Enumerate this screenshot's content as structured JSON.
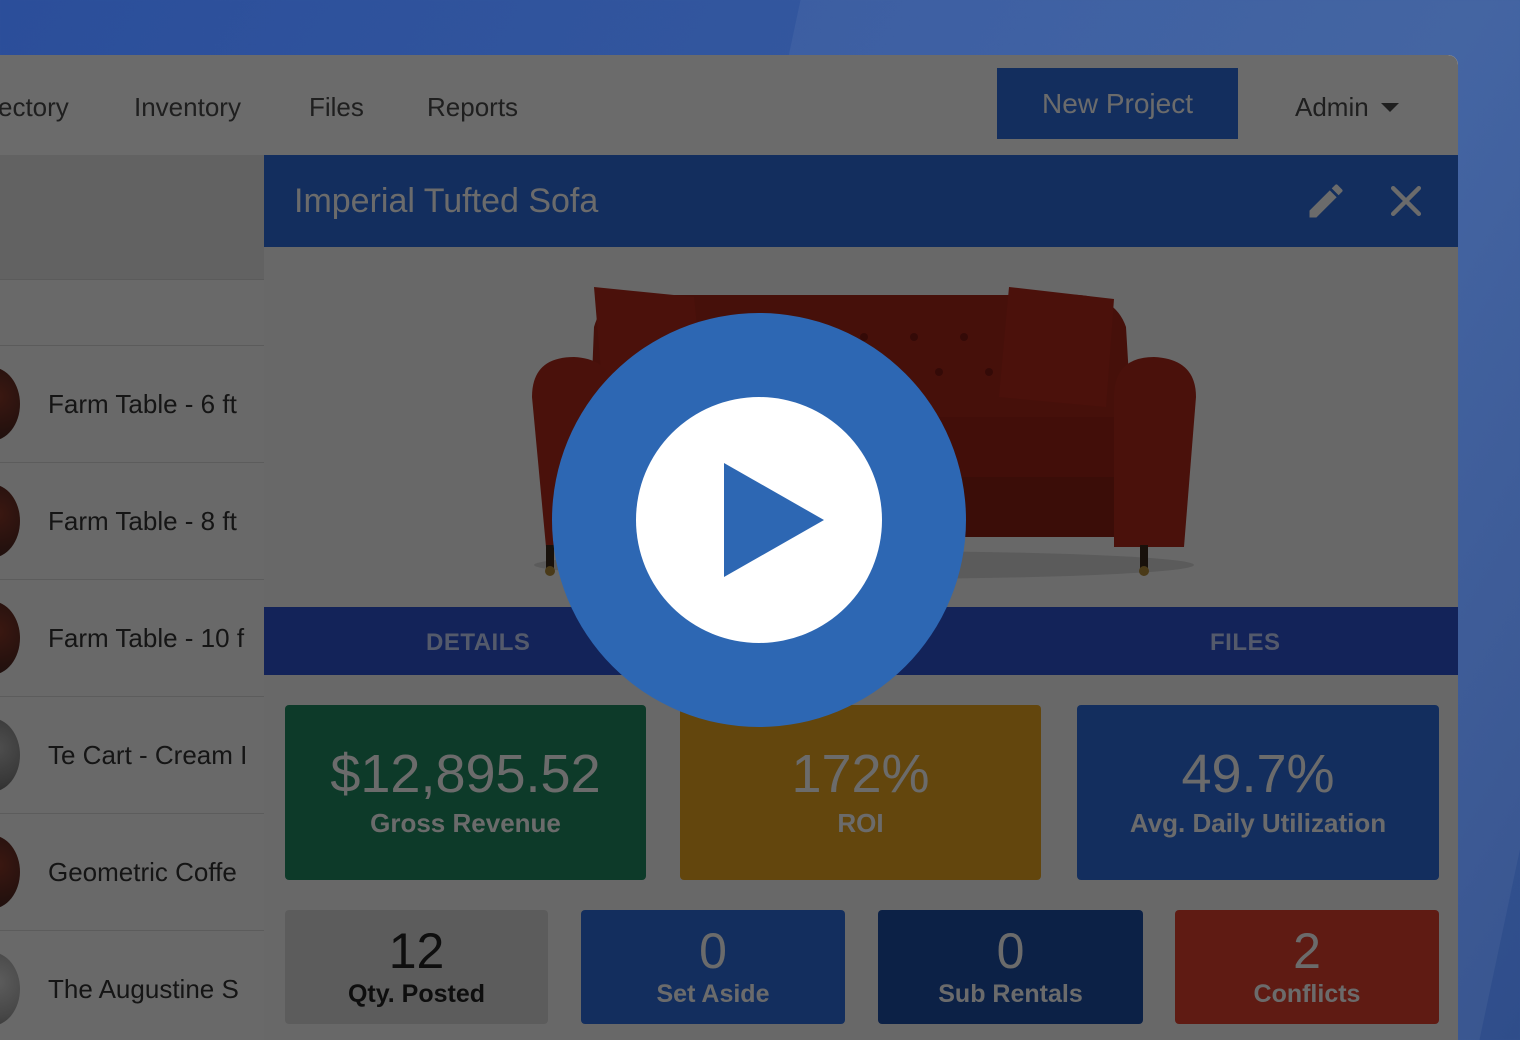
{
  "nav": {
    "links": [
      "ectory",
      "Inventory",
      "Files",
      "Reports"
    ],
    "new_project_label": "New Project",
    "admin_label": "Admin"
  },
  "left_list": {
    "items": [
      "Farm Table - 6 ft",
      "Farm Table - 8 ft",
      "Farm Table - 10 f",
      "Te Cart - Cream I",
      "Geometric Coffe",
      "The Augustine S"
    ]
  },
  "detail": {
    "title": "Imperial Tufted Sofa",
    "tabs": [
      "DETAILS",
      "FILES"
    ],
    "kpis": [
      {
        "value": "$12,895.52",
        "label": "Gross Revenue",
        "color": "#1f8a62"
      },
      {
        "value": "172%",
        "label": "ROI",
        "color": "#eca81f"
      },
      {
        "value": "49.7%",
        "label": "Avg. Daily Utilization",
        "color": "#2f6fe0"
      }
    ],
    "stats": [
      {
        "value": "12",
        "label": "Qty. Posted",
        "color": "#dcdcdc"
      },
      {
        "value": "0",
        "label": "Set Aside",
        "color": "#2f6fe0"
      },
      {
        "value": "0",
        "label": "Sub Rentals",
        "color": "#1e4fa8"
      },
      {
        "value": "2",
        "label": "Conflicts",
        "color": "#e2402f"
      }
    ]
  },
  "overlay": {
    "play_icon": "play-icon",
    "play_color": "#2d67b3"
  }
}
